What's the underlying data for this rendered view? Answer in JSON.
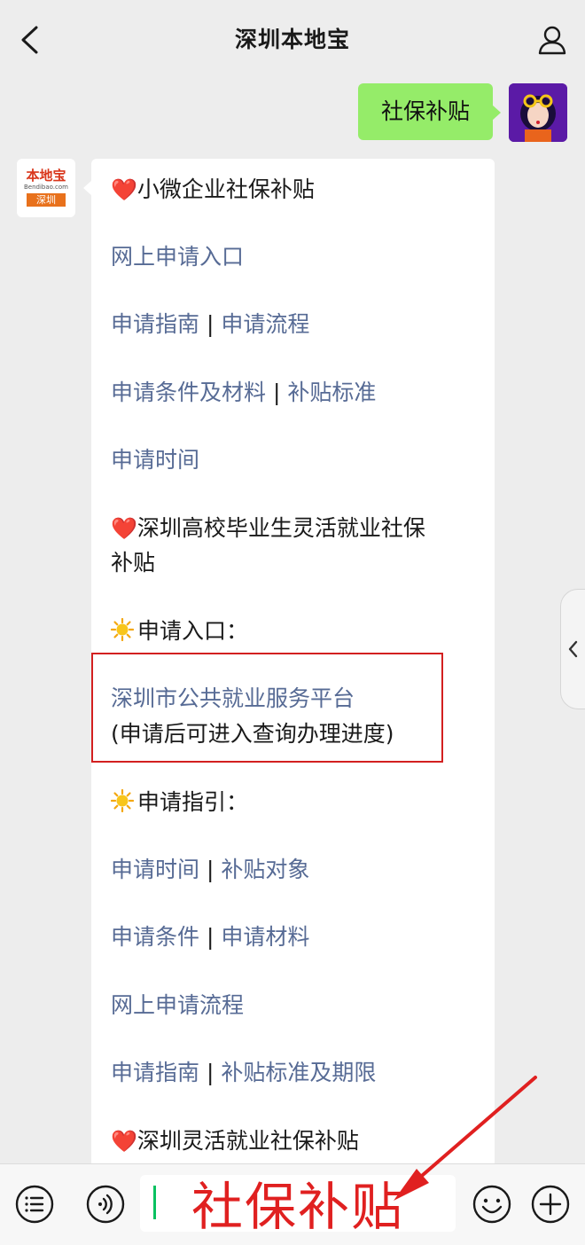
{
  "header": {
    "title": "深圳本地宝"
  },
  "outgoing": {
    "text": "社保补贴"
  },
  "bot": {
    "logo_top": "本地宝",
    "logo_sub": "Bendibao.com",
    "logo_tag": "深圳"
  },
  "message": {
    "section1_heart": "❤️",
    "section1_title": "小微企业社保补贴",
    "link_online_apply": "网上申请入口",
    "link_guide": "申请指南",
    "link_process": "申请流程",
    "link_conditions": "申请条件及材料",
    "link_standard": "补贴标准",
    "link_time": "申请时间",
    "section2_heart": "❤️",
    "section2_title_line1": "深圳高校毕业生灵活就业社保",
    "section2_title_line2": "补贴",
    "sun_apply_entry": "申请入口：",
    "link_platform": "深圳市公共就业服务平台",
    "platform_note": "(申请后可进入查询办理进度)",
    "sun_guide": "申请指引：",
    "link_time2": "申请时间",
    "link_targets": "补贴对象",
    "link_conditions2": "申请条件",
    "link_materials": "申请材料",
    "link_online_process": "网上申请流程",
    "link_guide2": "申请指南",
    "link_standard_period": "补贴标准及期限",
    "section3_heart": "❤️",
    "section3_title": "深圳灵活就业社保补贴",
    "separator": "|"
  },
  "input": {
    "value": "社保补贴"
  },
  "colors": {
    "link": "#576b95",
    "outgoing_bubble": "#95ec69",
    "highlight": "#d32020",
    "input_text": "#e02020"
  }
}
